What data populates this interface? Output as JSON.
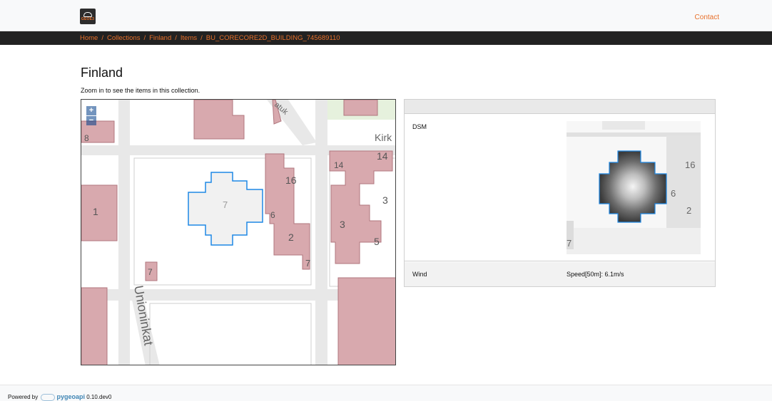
{
  "header": {
    "logo_text": "GEOE3",
    "contact_label": "Contact"
  },
  "breadcrumb": {
    "items": [
      "Home",
      "Collections",
      "Finland",
      "Items",
      "BU_CORECORE2D_BUILDING_745689110"
    ],
    "separator": "/"
  },
  "page": {
    "title": "Finland",
    "subtitle": "Zoom in to see the items in this collection."
  },
  "map": {
    "zoom_in": "+",
    "zoom_out": "−",
    "street_label_1": "Unioninkat",
    "street_label_2": "Kirk",
    "street_label_3": "atuk",
    "building_numbers": [
      "1",
      "7",
      "16",
      "14",
      "14",
      "3",
      "6",
      "2",
      "3",
      "5",
      "7",
      "7",
      "8"
    ]
  },
  "properties": {
    "rows": [
      {
        "label": "DSM",
        "value": ""
      },
      {
        "label": "Wind",
        "value": "Speed[50m]: 6.1m/s"
      }
    ]
  },
  "dsm_labels": [
    "16",
    "6",
    "2",
    "7"
  ],
  "footer": {
    "powered_by": "Powered by",
    "pygeoapi": "pygeoapi",
    "version": "0.10.dev0"
  },
  "colors": {
    "accent": "#e8702a",
    "building_fill": "#d8a9ae",
    "building_stroke": "#b0767e",
    "highlight": "#1e88e5"
  }
}
